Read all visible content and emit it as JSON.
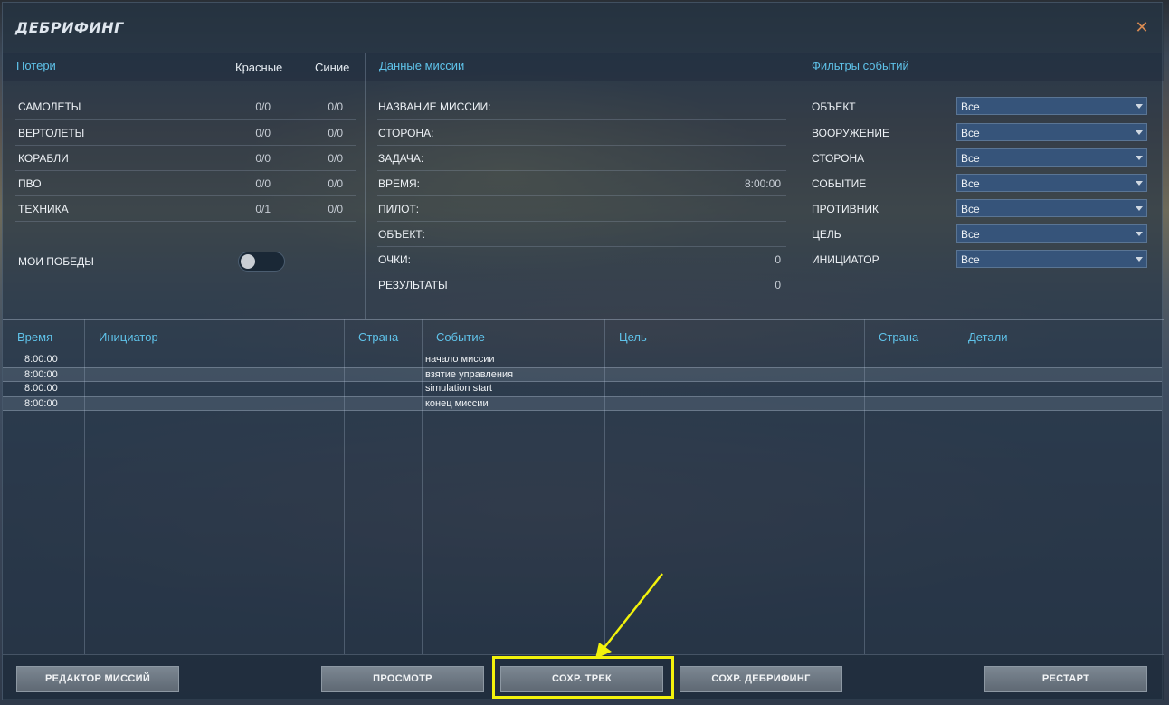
{
  "window": {
    "title": "ДЕБРИФИНГ",
    "close_icon": "close-icon"
  },
  "losses": {
    "heading": "Потери",
    "col_red": "Красные",
    "col_blue": "Синие",
    "rows": [
      {
        "label": "САМОЛЕТЫ",
        "red": "0/0",
        "blue": "0/0"
      },
      {
        "label": "ВЕРТОЛЕТЫ",
        "red": "0/0",
        "blue": "0/0"
      },
      {
        "label": "КОРАБЛИ",
        "red": "0/0",
        "blue": "0/0"
      },
      {
        "label": "ПВО",
        "red": "0/0",
        "blue": "0/0"
      },
      {
        "label": "ТЕХНИКА",
        "red": "0/1",
        "blue": "0/0"
      }
    ],
    "my_victories": "МОИ ПОБЕДЫ",
    "my_victories_on": false
  },
  "mission": {
    "heading": "Данные миссии",
    "rows": [
      {
        "label": "НАЗВАНИЕ МИССИИ:",
        "value": ""
      },
      {
        "label": "СТОРОНА:",
        "value": ""
      },
      {
        "label": "ЗАДАЧА:",
        "value": ""
      },
      {
        "label": "ВРЕМЯ:",
        "value": "8:00:00"
      },
      {
        "label": "ПИЛОТ:",
        "value": ""
      },
      {
        "label": "ОБЪЕКТ:",
        "value": ""
      },
      {
        "label": "ОЧКИ:",
        "value": "0"
      },
      {
        "label": "РЕЗУЛЬТАТЫ",
        "value": "0"
      }
    ]
  },
  "filters": {
    "heading": "Фильтры событий",
    "rows": [
      {
        "label": "ОБЪЕКТ",
        "value": "Все"
      },
      {
        "label": "ВООРУЖЕНИЕ",
        "value": "Все"
      },
      {
        "label": "СТОРОНА",
        "value": "Все"
      },
      {
        "label": "СОБЫТИЕ",
        "value": "Все"
      },
      {
        "label": "ПРОТИВНИК",
        "value": "Все"
      },
      {
        "label": "ЦЕЛЬ",
        "value": "Все"
      },
      {
        "label": "ИНИЦИАТОР",
        "value": "Все"
      }
    ]
  },
  "events": {
    "columns": [
      "Время",
      "Инициатор",
      "Страна",
      "Событие",
      "Цель",
      "Страна",
      "Детали"
    ],
    "rows": [
      [
        "8:00:00",
        "",
        "",
        "начало миссии",
        "",
        "",
        ""
      ],
      [
        "8:00:00",
        "",
        "",
        "взятие управления",
        "",
        "",
        ""
      ],
      [
        "8:00:00",
        "",
        "",
        "simulation start",
        "",
        "",
        ""
      ],
      [
        "8:00:00",
        "",
        "",
        "конец миссии",
        "",
        "",
        ""
      ]
    ]
  },
  "footer": {
    "mission_editor": "РЕДАКТОР МИССИЙ",
    "view": "ПРОСМОТР",
    "save_track": "СОХР. ТРЕК",
    "save_debriefing": "СОХР. ДЕБРИФИНГ",
    "restart": "РЕСТАРТ"
  },
  "colors": {
    "accent": "#5fc3ea",
    "highlight": "#f2f20c",
    "close": "#d88a52"
  }
}
